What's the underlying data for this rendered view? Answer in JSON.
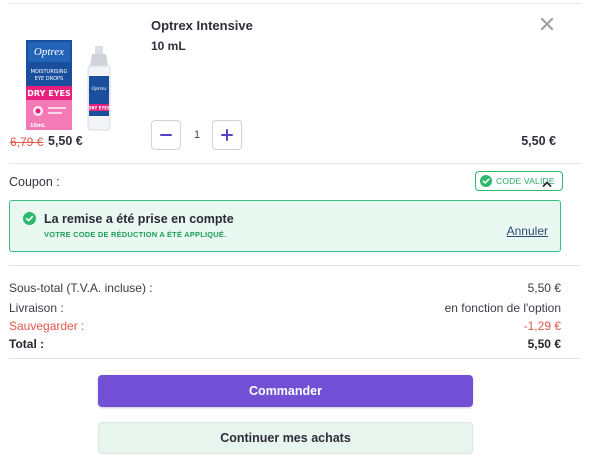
{
  "colors": {
    "accent": "#7150d6",
    "success": "#2db96b",
    "danger": "#e1574d",
    "brand_product": "#1a4f9e",
    "brand_pink": "#e6207f"
  },
  "product": {
    "name": "Optrex Intensive",
    "size": "10 mL",
    "old_price": "6,79 €",
    "new_price": "5,50 €",
    "quantity": "1",
    "line_total": "5,50 €",
    "remove_icon": "close-icon",
    "image": {
      "brand": "Optrex",
      "line1": "MOISTURISING",
      "line2": "EYE DROPS",
      "banner": "DRY EYES",
      "volume": "10mL",
      "bottle_brand": "Optrex",
      "bottle_banner": "DRY EYES"
    }
  },
  "coupon": {
    "label": "Coupon :",
    "badge": "CODE VALIDE",
    "badge_icon": "check-circle-icon",
    "toggle_icon": "chevron-up-icon"
  },
  "alert": {
    "title": "La remise a été prise en compte",
    "subtitle": "VOTRE CODE DE RÉDUCTION A ÉTÉ APPLIQUÉ.",
    "link": "Annuler",
    "icon": "check-circle-icon"
  },
  "summary": {
    "subtotal_label": "Sous-total (T.V.A. incluse) :",
    "subtotal_value": "5,50 €",
    "shipping_label": "Livraison :",
    "shipping_value": "en fonction de l'option",
    "savings_label": "Sauvegarder :",
    "savings_value": "-1,29 €",
    "total_label": "Total :",
    "total_value": "5,50 €"
  },
  "actions": {
    "order": "Commander",
    "continue": "Continuer mes achats"
  }
}
